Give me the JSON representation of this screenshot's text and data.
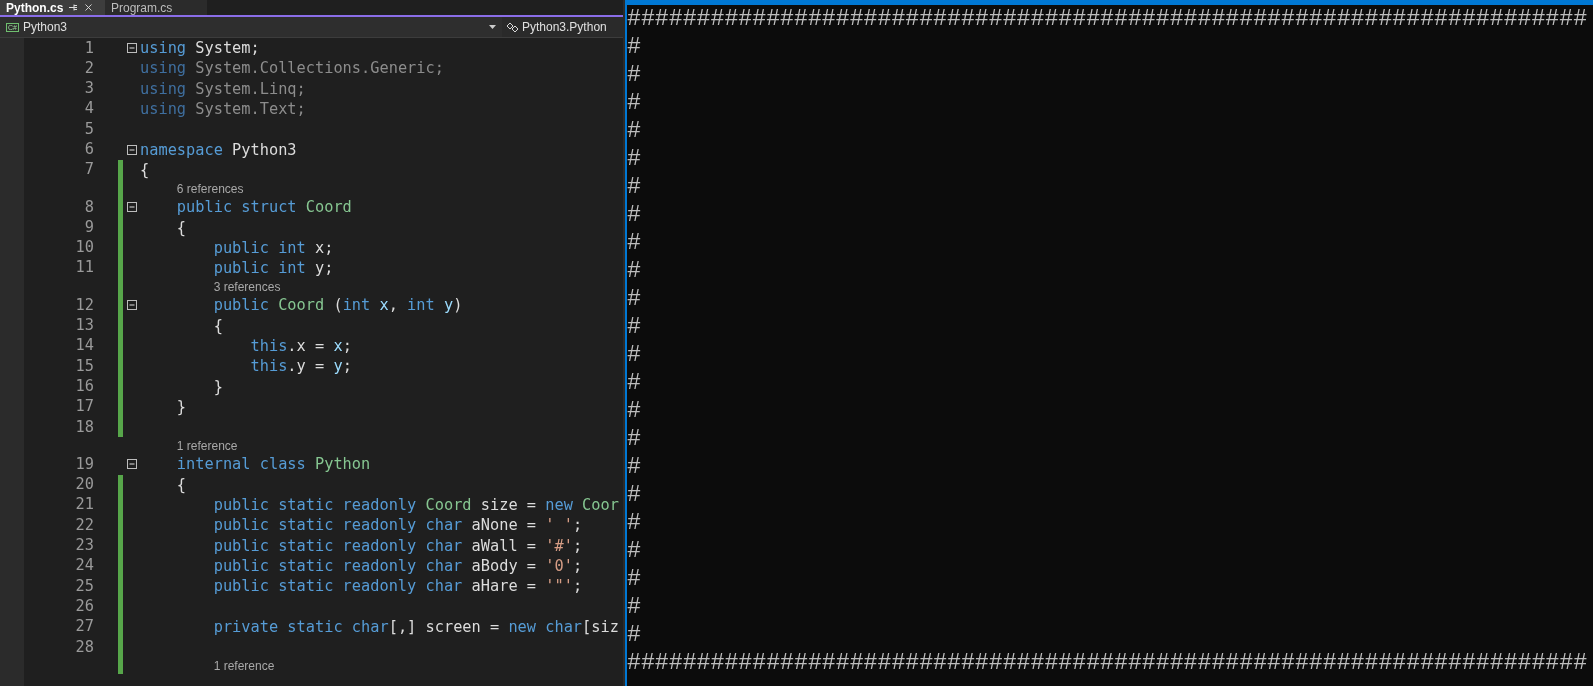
{
  "tabs": [
    {
      "label": "Python.cs",
      "selected": true
    },
    {
      "label": "Program.cs",
      "selected": false
    }
  ],
  "nav": {
    "project_badge": "C#",
    "project": "Python3",
    "member": "Python3.Python"
  },
  "lines": [
    {
      "num": "1",
      "fold": true,
      "changed": false,
      "faded": false,
      "tokens": [
        {
          "kind": "kw",
          "text": "using"
        },
        {
          "kind": "plain",
          "text": " System;"
        }
      ]
    },
    {
      "num": "2",
      "fold": false,
      "changed": false,
      "faded": true,
      "tokens": [
        {
          "kind": "kw",
          "text": "using"
        },
        {
          "kind": "plain",
          "text": " System.Collections.Generic;"
        }
      ]
    },
    {
      "num": "3",
      "fold": false,
      "changed": false,
      "faded": true,
      "tokens": [
        {
          "kind": "kw",
          "text": "using"
        },
        {
          "kind": "plain",
          "text": " System.Linq;"
        }
      ]
    },
    {
      "num": "4",
      "fold": false,
      "changed": false,
      "faded": true,
      "tokens": [
        {
          "kind": "kw",
          "text": "using"
        },
        {
          "kind": "plain",
          "text": " System.Text;"
        }
      ]
    },
    {
      "num": "5",
      "fold": false,
      "changed": false
    },
    {
      "num": "6",
      "fold": true,
      "changed": false,
      "faded": false,
      "tokens": [
        {
          "kind": "kw",
          "text": "namespace"
        },
        {
          "kind": "plain",
          "text": " Python3"
        }
      ]
    },
    {
      "num": "7",
      "fold": false,
      "changed": true,
      "faded": false,
      "tokens": [
        {
          "kind": "plain",
          "text": "{"
        }
      ]
    },
    {
      "num": "8",
      "lens": "6 references",
      "fold": true,
      "changed": true,
      "faded": false,
      "tokens": [
        {
          "kind": "kw",
          "text": "    public struct"
        },
        {
          "kind": "type",
          "text": " Coord"
        }
      ]
    },
    {
      "num": "9",
      "fold": false,
      "changed": true,
      "faded": false,
      "tokens": [
        {
          "kind": "plain",
          "text": "    {"
        }
      ]
    },
    {
      "num": "10",
      "fold": false,
      "changed": true,
      "faded": false,
      "tokens": [
        {
          "kind": "kw",
          "text": "        public int"
        },
        {
          "kind": "plain",
          "text": " x;"
        }
      ]
    },
    {
      "num": "11",
      "fold": false,
      "changed": true,
      "faded": false,
      "tokens": [
        {
          "kind": "kw",
          "text": "        public int"
        },
        {
          "kind": "plain",
          "text": " y;"
        }
      ]
    },
    {
      "num": "12",
      "lens": "3 references",
      "fold": true,
      "changed": true,
      "faded": false,
      "tokens": [
        {
          "kind": "kw",
          "text": "        public"
        },
        {
          "kind": "type",
          "text": " Coord"
        },
        {
          "kind": "plain",
          "text": " ("
        },
        {
          "kind": "kw",
          "text": "int"
        },
        {
          "kind": "param",
          "text": " x"
        },
        {
          "kind": "plain",
          "text": ", "
        },
        {
          "kind": "kw",
          "text": "int"
        },
        {
          "kind": "param",
          "text": " y"
        },
        {
          "kind": "plain",
          "text": ")"
        }
      ]
    },
    {
      "num": "13",
      "fold": false,
      "changed": true,
      "faded": false,
      "tokens": [
        {
          "kind": "plain",
          "text": "        {"
        }
      ]
    },
    {
      "num": "14",
      "fold": false,
      "changed": true,
      "faded": false,
      "tokens": [
        {
          "kind": "kw",
          "text": "            this"
        },
        {
          "kind": "plain",
          "text": ".x = "
        },
        {
          "kind": "param",
          "text": "x"
        },
        {
          "kind": "plain",
          "text": ";"
        }
      ]
    },
    {
      "num": "15",
      "fold": false,
      "changed": true,
      "faded": false,
      "tokens": [
        {
          "kind": "kw",
          "text": "            this"
        },
        {
          "kind": "plain",
          "text": ".y = "
        },
        {
          "kind": "param",
          "text": "y"
        },
        {
          "kind": "plain",
          "text": ";"
        }
      ]
    },
    {
      "num": "16",
      "fold": false,
      "changed": true,
      "faded": false,
      "tokens": [
        {
          "kind": "plain",
          "text": "        }"
        }
      ]
    },
    {
      "num": "17",
      "fold": false,
      "changed": true,
      "faded": false,
      "tokens": [
        {
          "kind": "plain",
          "text": "    }"
        }
      ]
    },
    {
      "num": "18",
      "fold": false,
      "changed": true
    },
    {
      "num": "19",
      "lens": "1 reference",
      "fold": true,
      "changed": false,
      "faded": false,
      "tokens": [
        {
          "kind": "kw",
          "text": "    internal class"
        },
        {
          "kind": "type",
          "text": " Python"
        }
      ]
    },
    {
      "num": "20",
      "fold": false,
      "changed": true,
      "faded": false,
      "tokens": [
        {
          "kind": "plain",
          "text": "    {"
        }
      ]
    },
    {
      "num": "21",
      "fold": false,
      "changed": true,
      "faded": false,
      "tokens": [
        {
          "kind": "kw",
          "text": "        public static readonly"
        },
        {
          "kind": "type",
          "text": " Coord"
        },
        {
          "kind": "plain",
          "text": " size = "
        },
        {
          "kind": "kw",
          "text": "new"
        },
        {
          "kind": "type",
          "text": " Coor"
        }
      ]
    },
    {
      "num": "22",
      "fold": false,
      "changed": true,
      "faded": false,
      "tokens": [
        {
          "kind": "kw",
          "text": "        public static readonly char"
        },
        {
          "kind": "plain",
          "text": " aNone = "
        },
        {
          "kind": "str",
          "text": "' '"
        },
        {
          "kind": "plain",
          "text": ";"
        }
      ]
    },
    {
      "num": "23",
      "fold": false,
      "changed": true,
      "faded": false,
      "tokens": [
        {
          "kind": "kw",
          "text": "        public static readonly char"
        },
        {
          "kind": "plain",
          "text": " aWall = "
        },
        {
          "kind": "str",
          "text": "'#'"
        },
        {
          "kind": "plain",
          "text": ";"
        }
      ]
    },
    {
      "num": "24",
      "fold": false,
      "changed": true,
      "faded": false,
      "tokens": [
        {
          "kind": "kw",
          "text": "        public static readonly char"
        },
        {
          "kind": "plain",
          "text": " aBody = "
        },
        {
          "kind": "str",
          "text": "'0'"
        },
        {
          "kind": "plain",
          "text": ";"
        }
      ]
    },
    {
      "num": "25",
      "fold": false,
      "changed": true,
      "faded": false,
      "tokens": [
        {
          "kind": "kw",
          "text": "        public static readonly char"
        },
        {
          "kind": "plain",
          "text": " aHare = "
        },
        {
          "kind": "str",
          "text": "'\"'"
        },
        {
          "kind": "plain",
          "text": ";"
        }
      ]
    },
    {
      "num": "26",
      "fold": false,
      "changed": true
    },
    {
      "num": "27",
      "fold": false,
      "changed": true,
      "faded": false,
      "tokens": [
        {
          "kind": "kw",
          "text": "        private static char"
        },
        {
          "kind": "plain",
          "text": "[,] screen = "
        },
        {
          "kind": "kw",
          "text": "new char"
        },
        {
          "kind": "plain",
          "text": "[siz"
        }
      ]
    },
    {
      "num": "28",
      "fold": false,
      "changed": true
    },
    {
      "lens": "1 reference",
      "fold": false,
      "changed": true
    }
  ],
  "console": {
    "lines": [
      "#####################################################################",
      "#",
      "#",
      "#",
      "#",
      "#",
      "#",
      "#",
      "#",
      "#",
      "#",
      "#",
      "#",
      "#",
      "#",
      "#",
      "#",
      "#",
      "#",
      "#",
      "#",
      "#",
      "#",
      "#####################################################################"
    ]
  }
}
